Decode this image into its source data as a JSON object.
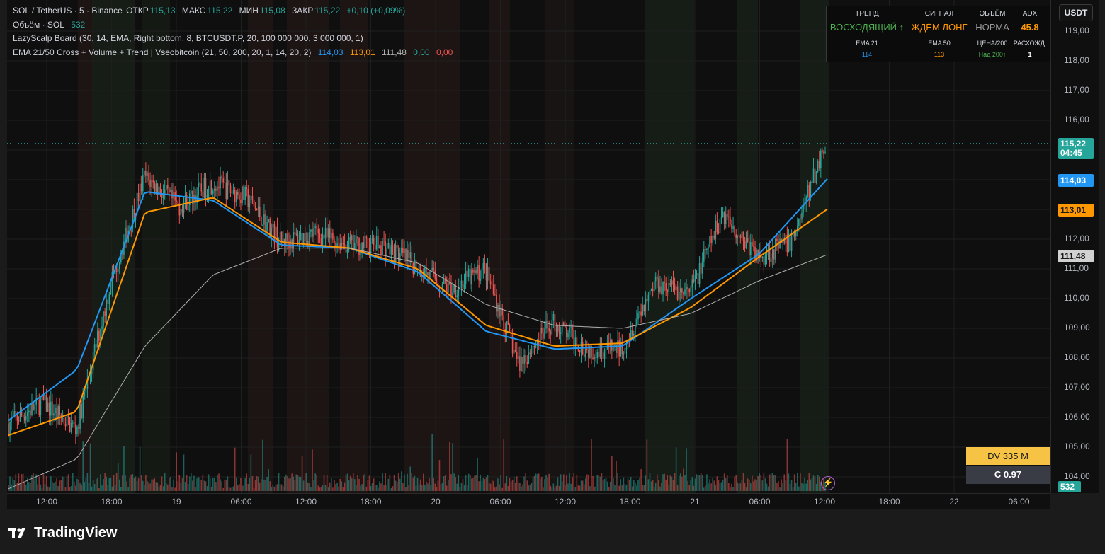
{
  "header": {
    "symbol_line": {
      "title": "SOL / TetherUS · 5 · Binance",
      "open_label": "ОТКР",
      "open_value": "115,13",
      "high_label": "МАКС",
      "high_value": "115,22",
      "low_label": "МИН",
      "low_value": "115,08",
      "close_label": "ЗАКР",
      "close_value": "115,22",
      "change": "+0,10 (+0,09%)"
    },
    "volume_line": {
      "label": "Объём · SOL",
      "value": "532"
    },
    "lazyscalp_line": {
      "label": "LazyScalp Board (30, 14, EMA, Right bottom, 8, BTCUSDT.P, 20, 100 000 000, 3 000 000, 1)"
    },
    "ema_line": {
      "label": "EMA 21/50 Cross + Volume + Trend | Vseobitcoin (21, 50, 200, 20, 1, 14, 20, 2)",
      "v1": "114,03",
      "v2": "113,01",
      "v3": "111,48",
      "v4": "0,00",
      "v5": "0,00"
    }
  },
  "currency_button": "USDT",
  "board": {
    "headers": [
      "ТРЕНД",
      "СИГНАЛ",
      "ОБЪЁМ",
      "ADX"
    ],
    "values": [
      "ВОСХОДЯЩИЙ ↑",
      "ЖДЁМ ЛОНГ",
      "НОРМА",
      "45.8"
    ],
    "sub_headers": [
      "EMA 21",
      "EMA 50",
      "ЦЕНА/200",
      "РАСХОЖД."
    ],
    "sub_values": [
      "114",
      "113",
      "Над 200↑",
      "1"
    ]
  },
  "price_axis": {
    "ticks": [
      "119,00",
      "118,00",
      "117,00",
      "116,00",
      "115,00",
      "114,00",
      "113,00",
      "112,00",
      "111,00",
      "110,00",
      "109,00",
      "108,00",
      "107,00",
      "106,00",
      "105,00",
      "104,00"
    ],
    "tags": {
      "last_price": "115,22",
      "countdown": "04:45",
      "ema21": "114,03",
      "ema50": "113,01",
      "ema200": "111,48",
      "volume": "532"
    }
  },
  "time_axis": {
    "ticks": [
      "12:00",
      "18:00",
      "19",
      "06:00",
      "12:00",
      "18:00",
      "20",
      "06:00",
      "12:00",
      "18:00",
      "21",
      "06:00",
      "12:00",
      "18:00",
      "22",
      "06:00"
    ]
  },
  "dv_box": "DV 335 M",
  "c_box": "C  0.97",
  "branding": "TradingView",
  "colors": {
    "up": "#26a69a",
    "down": "#ef5350",
    "ema21": "#2196f3",
    "ema50": "#ff9800",
    "ema200": "#b0b0b0",
    "trend_up": "#4caf50",
    "signal": "#ff9800",
    "adx": "#ff9800"
  },
  "chart_data": {
    "type": "line",
    "title": "SOL / TetherUS · 5 · Binance",
    "ylim": [
      103.6,
      119.4
    ],
    "x_ticks": [
      "12:00",
      "18:00",
      "19",
      "06:00",
      "12:00",
      "18:00",
      "20",
      "06:00",
      "12:00",
      "18:00",
      "21",
      "06:00",
      "12:00",
      "18:00",
      "22",
      "06:00"
    ],
    "x": [
      "12:00",
      "18:00",
      "19",
      "06:00",
      "12:00",
      "18:00",
      "20",
      "06:00",
      "12:00",
      "18:00",
      "21",
      "06:00",
      "12:00"
    ],
    "series": [
      {
        "name": "EMA 21",
        "color": "#2196f3",
        "values": [
          105.9,
          107.6,
          113.6,
          113.3,
          111.8,
          111.7,
          110.9,
          108.9,
          108.3,
          108.4,
          110.0,
          111.5,
          114.03
        ]
      },
      {
        "name": "EMA 50",
        "color": "#ff9800",
        "values": [
          105.4,
          106.2,
          112.9,
          113.4,
          111.9,
          111.7,
          111.0,
          109.1,
          108.4,
          108.5,
          109.7,
          111.4,
          113.01
        ]
      },
      {
        "name": "EMA 200",
        "color": "#b0b0b0",
        "values": [
          103.6,
          104.6,
          108.4,
          110.8,
          111.7,
          111.7,
          111.2,
          109.8,
          109.1,
          109.0,
          109.5,
          110.6,
          111.48
        ]
      }
    ],
    "price_path": [
      105.8,
      106.5,
      105.6,
      110.5,
      114.1,
      113.1,
      113.9,
      113.4,
      111.9,
      112.2,
      111.8,
      111.8,
      111.1,
      110.3,
      111.0,
      107.8,
      109.2,
      108.3,
      108.3,
      110.6,
      110.1,
      112.9,
      111.4,
      111.9,
      115.22
    ],
    "volume": {
      "last": 532
    },
    "grid": true
  }
}
